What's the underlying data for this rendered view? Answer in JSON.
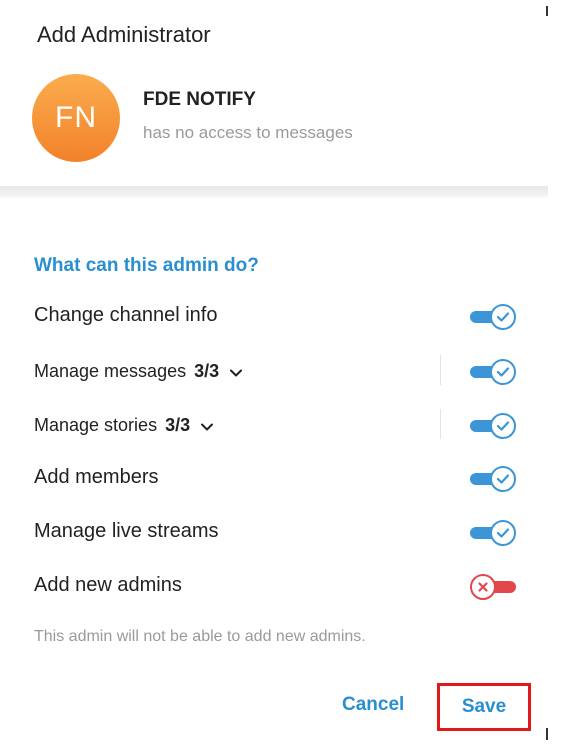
{
  "dialog": {
    "title": "Add Administrator"
  },
  "user": {
    "initials": "FN",
    "name": "FDE NOTIFY",
    "status": "has no access to messages",
    "avatar_color": "#f4902f"
  },
  "permissions": {
    "heading": "What can this admin do?",
    "items": [
      {
        "label": "Change channel info",
        "enabled": true
      },
      {
        "label": "Manage messages",
        "count": "3/3",
        "expandable": true,
        "enabled": true
      },
      {
        "label": "Manage stories",
        "count": "3/3",
        "expandable": true,
        "enabled": true
      },
      {
        "label": "Add members",
        "enabled": true
      },
      {
        "label": "Manage live streams",
        "enabled": true
      },
      {
        "label": "Add new admins",
        "enabled": false
      }
    ],
    "note": "This admin will not be able to add new admins."
  },
  "footer": {
    "cancel_label": "Cancel",
    "save_label": "Save"
  },
  "colors": {
    "accent": "#2a8fd0",
    "toggle_on": "#3b95d6",
    "toggle_off": "#e0484e",
    "highlight_box": "#e01a1a"
  },
  "icons": [
    "chevron-down-icon",
    "check-icon",
    "x-icon"
  ]
}
